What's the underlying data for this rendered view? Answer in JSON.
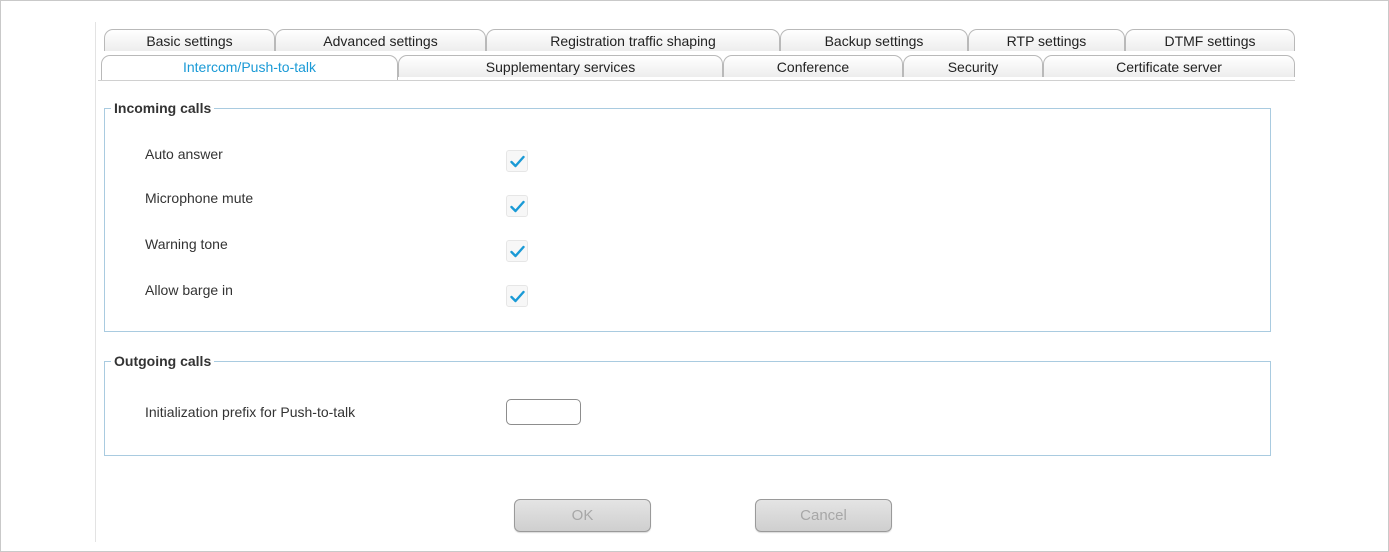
{
  "colors": {
    "accent": "#1a9ad6",
    "checkmark": "#1a9ad6",
    "group_border": "#a9cbe0",
    "button_text_disabled": "#a7a7a7"
  },
  "tabs_row1": [
    {
      "label": "Basic settings"
    },
    {
      "label": "Advanced settings"
    },
    {
      "label": "Registration traffic shaping"
    },
    {
      "label": "Backup settings"
    },
    {
      "label": "RTP settings"
    },
    {
      "label": "DTMF settings"
    }
  ],
  "tabs_row2": [
    {
      "label": "Intercom/Push-to-talk",
      "active": true
    },
    {
      "label": "Supplementary services"
    },
    {
      "label": "Conference"
    },
    {
      "label": "Security"
    },
    {
      "label": "Certificate server"
    }
  ],
  "incoming": {
    "legend": "Incoming calls",
    "rows": [
      {
        "label": "Auto answer",
        "checked": true
      },
      {
        "label": "Microphone mute",
        "checked": true
      },
      {
        "label": "Warning tone",
        "checked": true
      },
      {
        "label": "Allow barge in",
        "checked": true
      }
    ]
  },
  "outgoing": {
    "legend": "Outgoing calls",
    "prefix_label": "Initialization prefix for Push-to-talk",
    "prefix_value": ""
  },
  "buttons": {
    "ok_label": "OK",
    "cancel_label": "Cancel"
  },
  "icons": {
    "checkmark": "check-icon"
  }
}
